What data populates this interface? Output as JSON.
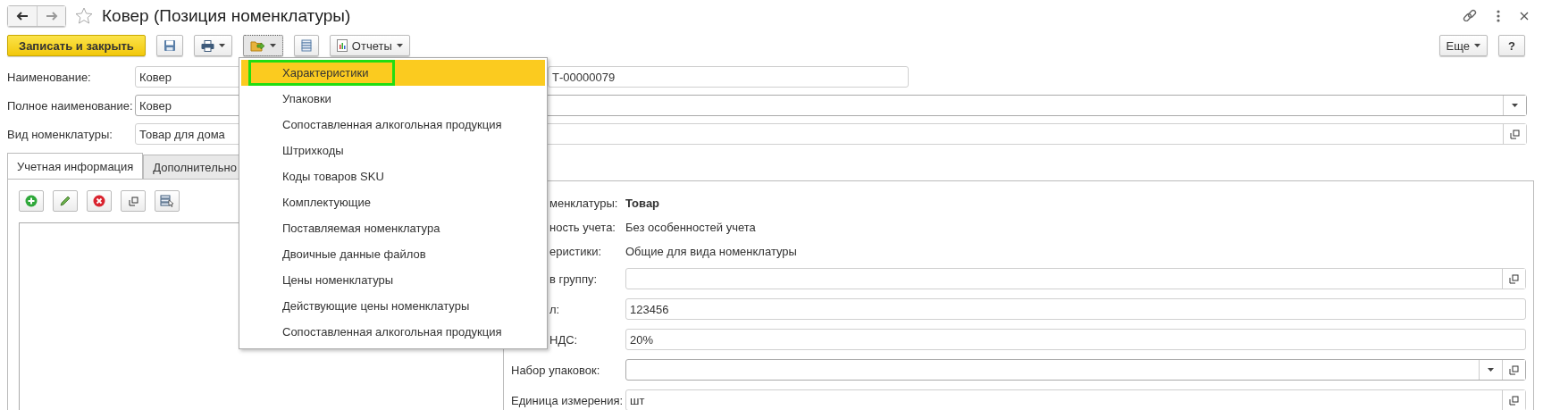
{
  "window": {
    "title": "Ковер (Позиция номенклатуры)",
    "favorite": false
  },
  "toolbar": {
    "save_close": "Записать и закрыть",
    "reports": "Отчеты",
    "more": "Еще",
    "help": "?"
  },
  "form": {
    "name_label": "Наименование:",
    "name_value": "Ковер",
    "code_value": "Т-00000079",
    "full_name_label": "Полное наименование:",
    "full_name_value": "Ковер",
    "kind_label": "Вид номенклатуры:",
    "kind_value": "Товар для дома"
  },
  "tabs": [
    {
      "label": "Учетная информация",
      "selected": true
    },
    {
      "label": "Дополнительно",
      "selected": false
    }
  ],
  "details": [
    {
      "kind": "text",
      "label": "менклатуры:",
      "value": "Товар",
      "bold": true,
      "label_cut": true
    },
    {
      "kind": "text",
      "label": "ность учета:",
      "value": "Без особенностей учета",
      "bold": false,
      "label_cut": true
    },
    {
      "kind": "text",
      "label": "еристики:",
      "value": "Общие для вида номенклатуры",
      "bold": false,
      "label_cut": true
    },
    {
      "kind": "open",
      "label": "в группу:",
      "label_cut": true
    },
    {
      "kind": "input",
      "label": "л:",
      "value": "123456",
      "label_cut": true
    },
    {
      "kind": "input",
      "label": "НДС:",
      "value": "20%",
      "label_cut": true
    },
    {
      "kind": "select_open",
      "label": "Набор упаковок:",
      "label_cut": false
    },
    {
      "kind": "open",
      "label": "Единица измерения:",
      "value": "шт",
      "label_cut": false
    }
  ],
  "menu": {
    "items": [
      {
        "label": "Характеристики",
        "selected": true
      },
      {
        "label": "Упаковки",
        "selected": false
      },
      {
        "label": "Сопоставленная алкогольная продукция",
        "selected": false
      },
      {
        "label": "Штрихкоды",
        "selected": false
      },
      {
        "label": "Коды товаров SKU",
        "selected": false
      },
      {
        "label": "Комплектующие",
        "selected": false
      },
      {
        "label": "Поставляемая номенклатура",
        "selected": false
      },
      {
        "label": "Двоичные данные файлов",
        "selected": false
      },
      {
        "label": "Цены номенклатуры",
        "selected": false
      },
      {
        "label": "Действующие цены номенклатуры",
        "selected": false
      },
      {
        "label": "Сопоставленная алкогольная продукция",
        "selected": false
      }
    ]
  }
}
